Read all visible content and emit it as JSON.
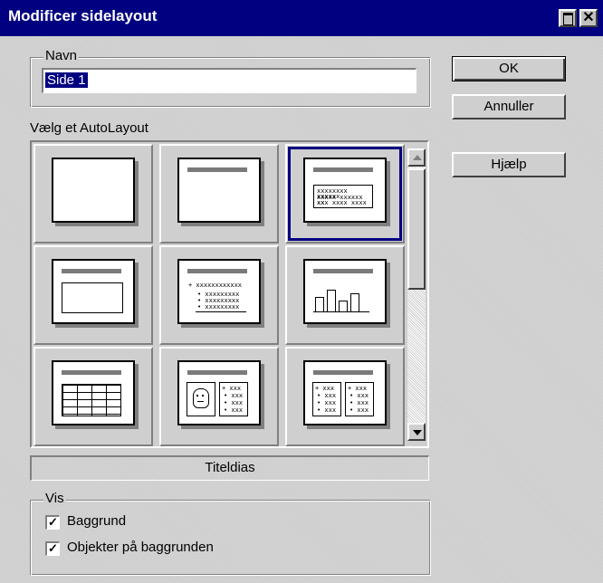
{
  "window": {
    "title": "Modificer sidelayout",
    "close_glyph": "✕"
  },
  "name_group": {
    "legend": "Navn",
    "value": "Side 1"
  },
  "buttons": {
    "ok": "OK",
    "cancel": "Annuller",
    "help": "Hjælp"
  },
  "layout_group": {
    "label": "Vælg et AutoLayout",
    "selected_caption": "Titeldias",
    "tiles": [
      {
        "icon": "blank-layout-icon",
        "selected": false
      },
      {
        "icon": "title-only-layout-icon",
        "selected": false
      },
      {
        "icon": "title-slide-layout-icon",
        "selected": true
      },
      {
        "icon": "title-content-layout-icon",
        "selected": false
      },
      {
        "icon": "title-bullets-layout-icon",
        "selected": false
      },
      {
        "icon": "title-chart-layout-icon",
        "selected": false
      },
      {
        "icon": "title-table-layout-icon",
        "selected": false
      },
      {
        "icon": "title-clipart-bullets-layout-icon",
        "selected": false
      },
      {
        "icon": "title-two-columns-layout-icon",
        "selected": false
      }
    ]
  },
  "view_group": {
    "legend": "Vis",
    "options": [
      {
        "label": "Baggrund",
        "checked": true
      },
      {
        "label": "Objekter på baggrunden",
        "checked": true
      }
    ]
  },
  "colors": {
    "titlebar": "#000080",
    "selection": "#000080",
    "face": "#cfcfcf"
  }
}
